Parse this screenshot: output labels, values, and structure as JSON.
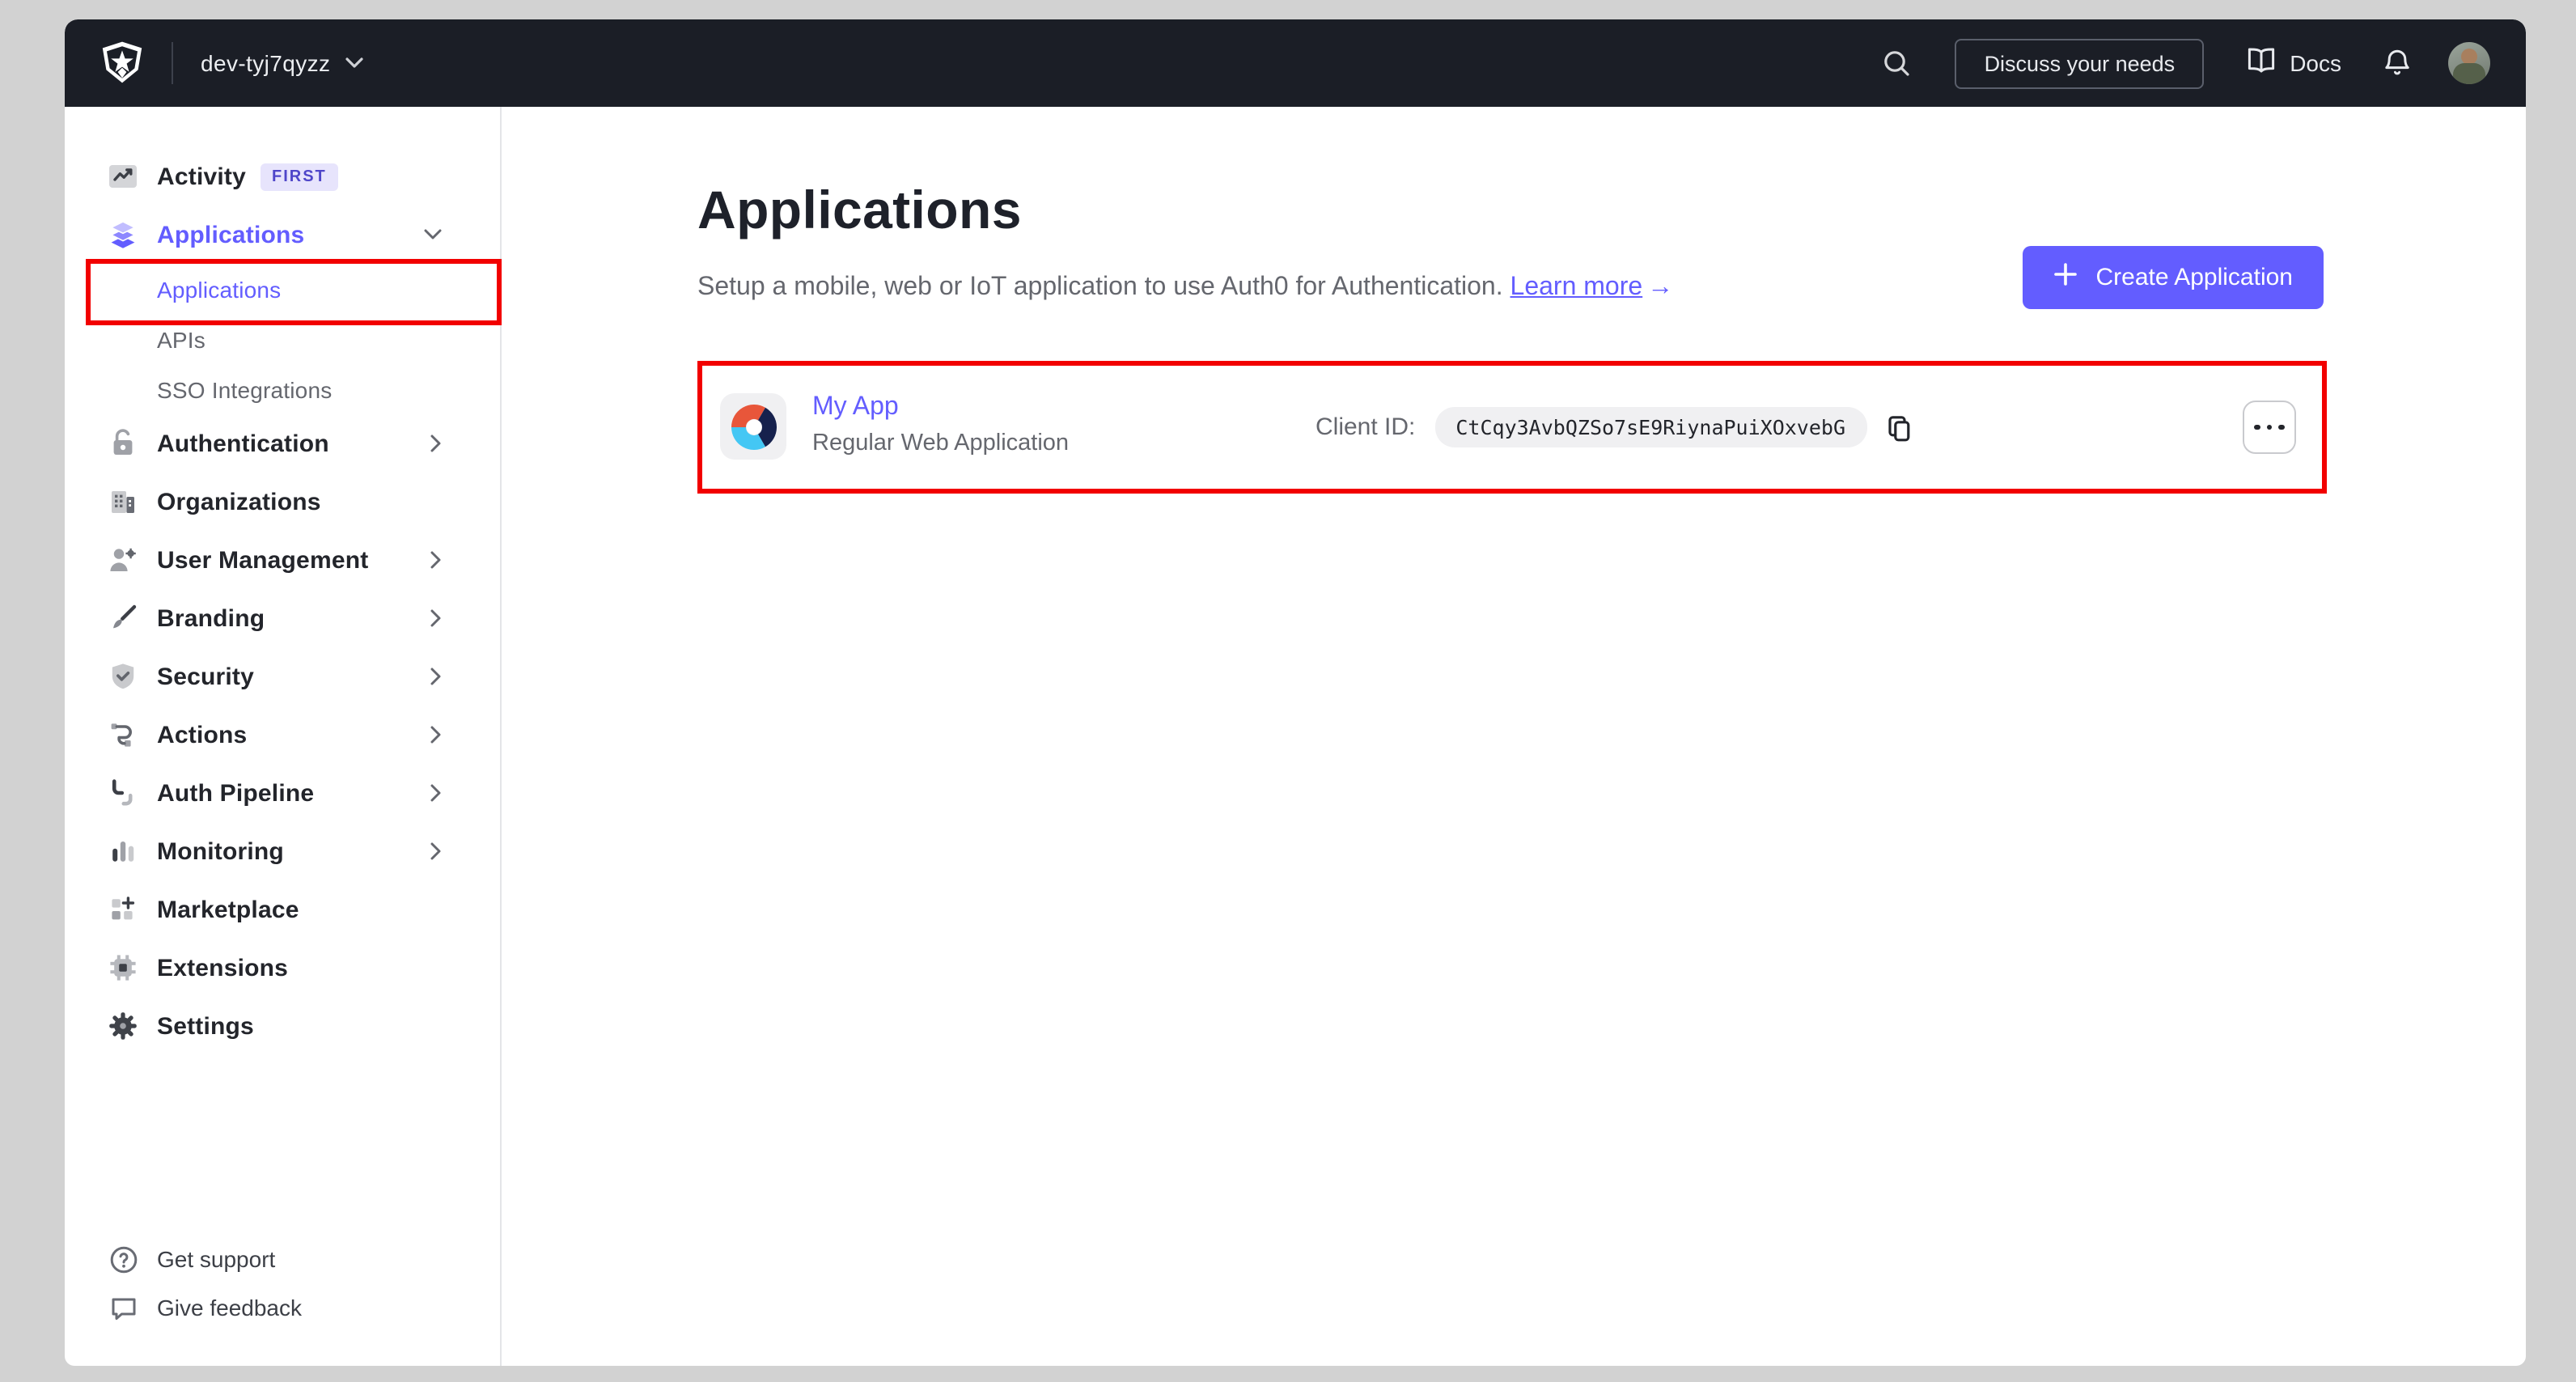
{
  "header": {
    "tenant_name": "dev-tyj7qyzz",
    "discuss_button_label": "Discuss your needs",
    "docs_label": "Docs"
  },
  "sidebar": {
    "items": [
      {
        "label": "Activity",
        "badge": "FIRST",
        "icon": "activity-icon",
        "level": "main"
      },
      {
        "label": "Applications",
        "icon": "applications-layers-icon",
        "level": "main",
        "active": true,
        "chevron": "down"
      },
      {
        "label": "Applications",
        "level": "sub",
        "active": true,
        "annotated_with_red_box": true
      },
      {
        "label": "APIs",
        "level": "sub"
      },
      {
        "label": "SSO Integrations",
        "level": "sub"
      },
      {
        "label": "Authentication",
        "icon": "padlock-icon",
        "level": "main",
        "chevron": "right"
      },
      {
        "label": "Organizations",
        "icon": "organization-building-icon",
        "level": "main"
      },
      {
        "label": "User Management",
        "icon": "user-gear-icon",
        "level": "main",
        "chevron": "right"
      },
      {
        "label": "Branding",
        "icon": "paintbrush-icon",
        "level": "main",
        "chevron": "right"
      },
      {
        "label": "Security",
        "icon": "shield-check-icon",
        "level": "main",
        "chevron": "right"
      },
      {
        "label": "Actions",
        "icon": "flow-icon",
        "level": "main",
        "chevron": "right"
      },
      {
        "label": "Auth Pipeline",
        "icon": "pipeline-icon",
        "level": "main",
        "chevron": "right"
      },
      {
        "label": "Monitoring",
        "icon": "bar-chart-icon",
        "level": "main",
        "chevron": "right"
      },
      {
        "label": "Marketplace",
        "icon": "marketplace-grid-plus-icon",
        "level": "main"
      },
      {
        "label": "Extensions",
        "icon": "chip-icon",
        "level": "main"
      },
      {
        "label": "Settings",
        "icon": "gear-icon",
        "level": "main"
      }
    ],
    "footer_items": [
      {
        "label": "Get support",
        "icon": "help-circle-icon"
      },
      {
        "label": "Give feedback",
        "icon": "feedback-bubble-icon"
      }
    ]
  },
  "main": {
    "title": "Applications",
    "subtitle": "Setup a mobile, web or IoT application to use Auth0 for Authentication.",
    "learn_more_label": "Learn more",
    "learn_more_arrow": "→",
    "create_button_label": "Create Application",
    "app_row": {
      "name": "My App",
      "type": "Regular Web Application",
      "client_id_label": "Client ID:",
      "client_id": "CtCqy3AvbQZSo7sE9RiynaPuiXOxvebG"
    }
  },
  "icons": {
    "search": "magnifier",
    "docs": "open-book",
    "notifications": "bell",
    "tenant_switcher": "chevron-down",
    "create": "plus",
    "copy": "overlapping-squares",
    "more": "horizontal-ellipsis",
    "app_logo": "tri-color-donut"
  },
  "colors": {
    "accent_indigo": "#635dff",
    "annotation_red": "#f20000",
    "header_background": "#1b1e26",
    "page_margin_gray": "#d2d2d2",
    "dark_text": "#1e212a",
    "muted_text": "#65676e",
    "badge_background": "#e7e4fc",
    "pill_background": "#f0f0f2",
    "app_icon_orange": "#e8563a",
    "app_icon_navy": "#16214d",
    "app_icon_blue": "#44c7f4"
  }
}
